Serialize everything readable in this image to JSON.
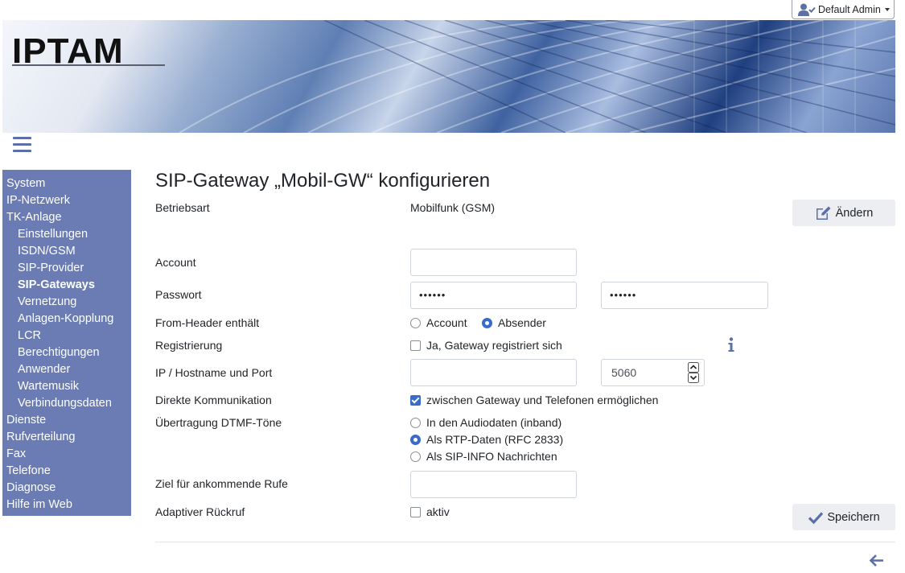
{
  "header": {
    "user_name": "Default Admin",
    "logo_text": "IPTAM",
    "user_icon": "user-check-icon"
  },
  "sidebar": {
    "items": [
      {
        "label": "System"
      },
      {
        "label": "IP-Netzwerk"
      },
      {
        "label": "TK-Anlage"
      },
      {
        "label": "Einstellungen"
      },
      {
        "label": "ISDN/GSM"
      },
      {
        "label": "SIP-Provider"
      },
      {
        "label": "SIP-Gateways"
      },
      {
        "label": "Vernetzung"
      },
      {
        "label": "Anlagen-Kopplung"
      },
      {
        "label": "LCR"
      },
      {
        "label": "Berechtigungen"
      },
      {
        "label": "Anwender"
      },
      {
        "label": "Wartemusik"
      },
      {
        "label": "Verbindungsdaten"
      },
      {
        "label": "Dienste"
      },
      {
        "label": "Rufverteilung"
      },
      {
        "label": "Fax"
      },
      {
        "label": "Telefone"
      },
      {
        "label": "Diagnose"
      },
      {
        "label": "Hilfe im Web"
      }
    ],
    "active": "SIP-Gateways",
    "color": "#6a7cb3"
  },
  "main": {
    "title": "SIP-Gateway „Mobil-GW“ konfigurieren",
    "edit_button": "Ändern",
    "save_button": "Speichern",
    "betriebsart": {
      "label": "Betriebsart",
      "value": "Mobilfunk (GSM)"
    },
    "account": {
      "label": "Account",
      "value": ""
    },
    "password": {
      "label": "Passwort",
      "value": "••••••",
      "confirm": "••••••"
    },
    "from_header": {
      "label": "From-Header enthält",
      "options": [
        "Account",
        "Absender"
      ],
      "selected": "Absender"
    },
    "registrierung": {
      "label": "Registrierung",
      "checkbox": "Ja, Gateway registriert sich",
      "checked": false
    },
    "host": {
      "label": "IP / Hostname und Port",
      "value": "",
      "port": "5060"
    },
    "direkt": {
      "label": "Direkte Kommunikation",
      "checkbox": "zwischen Gateway und Telefonen ermöglichen",
      "checked": true
    },
    "dtmf": {
      "label": "Übertragung DTMF-Töne",
      "options": [
        "In den Audiodaten (inband)",
        "Als RTP-Daten (RFC 2833)",
        "Als SIP-INFO Nachrichten"
      ],
      "selected": "Als RTP-Daten (RFC 2833)"
    },
    "ziel": {
      "label": "Ziel für ankommende Rufe",
      "value": ""
    },
    "rueckruf": {
      "label": "Adaptiver Rückruf",
      "checkbox": "aktiv",
      "checked": false
    }
  },
  "colors": {
    "accent": "#3b6bc9",
    "sidebar": "#6a7cb3",
    "icon": "#5b6fa8"
  }
}
